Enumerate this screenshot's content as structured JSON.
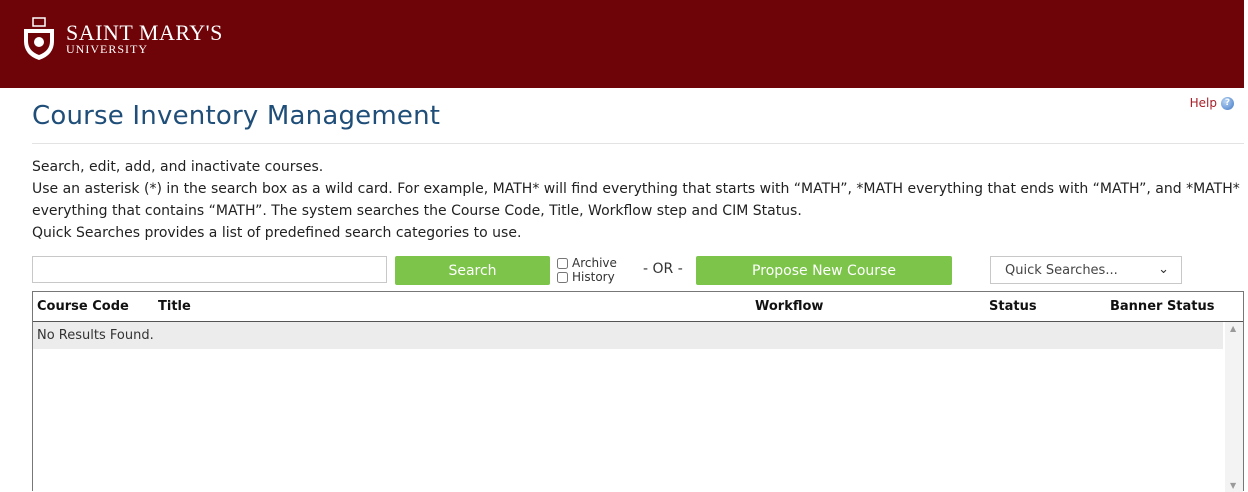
{
  "header": {
    "logo_line1": "SAINT MARY'S",
    "logo_line2": "UNIVERSITY",
    "brand_color": "#6f0408"
  },
  "help": {
    "label": "Help",
    "icon": "help-icon"
  },
  "page": {
    "title": "Course Inventory Management"
  },
  "description": {
    "line1": "Search, edit, add, and inactivate courses.",
    "line2": "Use an asterisk (*) in the search box as a wild card. For example, MATH* will find everything that starts with “MATH”, *MATH everything that ends with “MATH”, and *MATH* everything that contains “MATH”. The system searches the Course Code, Title, Workflow step and CIM Status.",
    "line3": "Quick Searches provides a list of predefined search categories to use."
  },
  "search": {
    "input_value": "",
    "button_label": "Search",
    "archive_label": "Archive",
    "history_label": "History",
    "or_label": "- OR -",
    "propose_label": "Propose New Course",
    "quick_searches_label": "Quick Searches...",
    "button_color": "#7cc54a"
  },
  "results": {
    "columns": [
      "Course Code",
      "Title",
      "Workflow",
      "Status",
      "Banner Status"
    ],
    "empty_message": "No Results Found."
  }
}
